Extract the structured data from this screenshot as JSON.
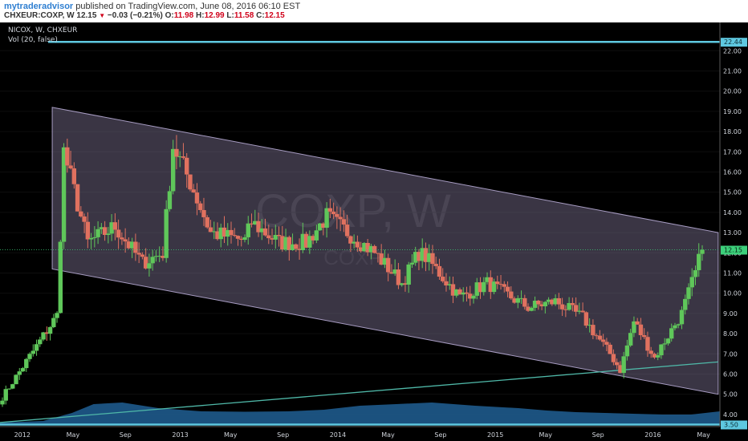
{
  "header": {
    "author": "mytraderadvisor",
    "published": "published on TradingView.com, June 08, 2016 06:10 EST",
    "symbol_line": "CHXEUR:COXP, W",
    "last": "12.15",
    "change": "−0.03 (−0.21%)",
    "o_label": "O:",
    "o_val": "11.98",
    "h_label": "H:",
    "h_val": "12.99",
    "l_label": "L:",
    "l_val": "11.58",
    "c_label": "C:",
    "c_val": "12.15"
  },
  "chart": {
    "symbol": "NICOX, W, CHXEUR",
    "indicator": "Vol (20, false)",
    "watermark": "COXP, W",
    "watermark_sub": "COXP",
    "price_label": "12.15",
    "top_label": "22.44",
    "bottom_label": "3.50",
    "colors": {
      "background": "#000000",
      "up": "#5fc75a",
      "down": "#e0715f",
      "channel_fill": "#8a7fa3",
      "volume_area": "#1e5a8c",
      "trendline": "#4fb8a8",
      "hline": "#5ec8e0",
      "price_line": "#3ccf7a"
    }
  },
  "chart_data": {
    "type": "candlestick",
    "x_ticks": [
      "2012",
      "May",
      "Sep",
      "2013",
      "May",
      "Sep",
      "2014",
      "May",
      "Sep",
      "2015",
      "May",
      "Sep",
      "2016",
      "May"
    ],
    "y_ticks": [
      "4.00",
      "5.00",
      "6.00",
      "7.00",
      "8.00",
      "9.00",
      "10.00",
      "11.00",
      "12.00",
      "13.00",
      "14.00",
      "15.00",
      "16.00",
      "17.00",
      "18.00",
      "19.00",
      "20.00",
      "21.00",
      "22.00"
    ],
    "ylim": [
      3.4,
      23.4
    ],
    "x_range": [
      "2011-11-20",
      "2016-06-14"
    ],
    "last_close": 12.15,
    "horizontal_lines": [
      22.44,
      3.5
    ],
    "channel": {
      "upper": [
        [
          "2012-03-20",
          19.2
        ],
        [
          "2016-06-10",
          13.0
        ]
      ],
      "lower": [
        [
          "2012-03-20",
          11.2
        ],
        [
          "2016-06-10",
          5.0
        ]
      ]
    },
    "trendline": [
      [
        "2011-11-20",
        3.6
      ],
      [
        "2016-06-10",
        6.6
      ]
    ],
    "series": [
      {
        "weeks": 17,
        "start": 4.6,
        "end": 8.9
      },
      {
        "weeks": 2,
        "start": 8.9,
        "end": 17.0
      },
      {
        "weeks": 7,
        "start": 17.0,
        "end": 12.5
      },
      {
        "weeks": 8,
        "start": 12.5,
        "end": 13.3
      },
      {
        "weeks": 8,
        "start": 13.3,
        "end": 11.5
      },
      {
        "weeks": 6,
        "start": 11.5,
        "end": 12.0
      },
      {
        "weeks": 3,
        "start": 12.0,
        "end": 17.3
      },
      {
        "weeks": 5,
        "start": 17.3,
        "end": 15.5
      },
      {
        "weeks": 6,
        "start": 15.5,
        "end": 13.0
      },
      {
        "weeks": 10,
        "start": 13.0,
        "end": 12.6
      },
      {
        "weeks": 2,
        "start": 12.6,
        "end": 13.5
      },
      {
        "weeks": 8,
        "start": 13.5,
        "end": 12.5
      },
      {
        "weeks": 8,
        "start": 12.5,
        "end": 12.5
      },
      {
        "weeks": 6,
        "start": 12.5,
        "end": 13.8
      },
      {
        "weeks": 14,
        "start": 13.8,
        "end": 12.0
      },
      {
        "weeks": 8,
        "start": 12.0,
        "end": 10.5
      },
      {
        "weeks": 5,
        "start": 10.5,
        "end": 12.0
      },
      {
        "weeks": 2,
        "start": 12.0,
        "end": 11.8
      },
      {
        "weeks": 10,
        "start": 11.8,
        "end": 9.8
      },
      {
        "weeks": 8,
        "start": 9.8,
        "end": 10.5
      },
      {
        "weeks": 12,
        "start": 10.5,
        "end": 9.3
      },
      {
        "weeks": 8,
        "start": 9.3,
        "end": 9.6
      },
      {
        "weeks": 8,
        "start": 9.6,
        "end": 8.8
      },
      {
        "weeks": 8,
        "start": 8.8,
        "end": 7.0
      },
      {
        "weeks": 3,
        "start": 7.0,
        "end": 6.2
      },
      {
        "weeks": 4,
        "start": 6.2,
        "end": 8.6
      },
      {
        "weeks": 6,
        "start": 8.6,
        "end": 6.8
      },
      {
        "weeks": 8,
        "start": 6.8,
        "end": 9.0
      },
      {
        "weeks": 4,
        "start": 9.0,
        "end": 11.0
      },
      {
        "weeks": 2,
        "start": 11.0,
        "end": 12.15
      }
    ],
    "volume": {
      "max": 10,
      "levels": [
        [
          0.0,
          0.6
        ],
        [
          0.06,
          1.0
        ],
        [
          0.1,
          3.0
        ],
        [
          0.13,
          5.2
        ],
        [
          0.17,
          5.6
        ],
        [
          0.22,
          4.2
        ],
        [
          0.28,
          3.4
        ],
        [
          0.34,
          3.3
        ],
        [
          0.4,
          3.4
        ],
        [
          0.45,
          3.8
        ],
        [
          0.5,
          4.8
        ],
        [
          0.55,
          5.2
        ],
        [
          0.6,
          5.6
        ],
        [
          0.66,
          4.8
        ],
        [
          0.72,
          4.2
        ],
        [
          0.76,
          3.6
        ],
        [
          0.8,
          3.2
        ],
        [
          0.84,
          3.0
        ],
        [
          0.88,
          2.8
        ],
        [
          0.92,
          2.6
        ],
        [
          0.96,
          2.6
        ],
        [
          1.0,
          3.4
        ]
      ]
    }
  }
}
